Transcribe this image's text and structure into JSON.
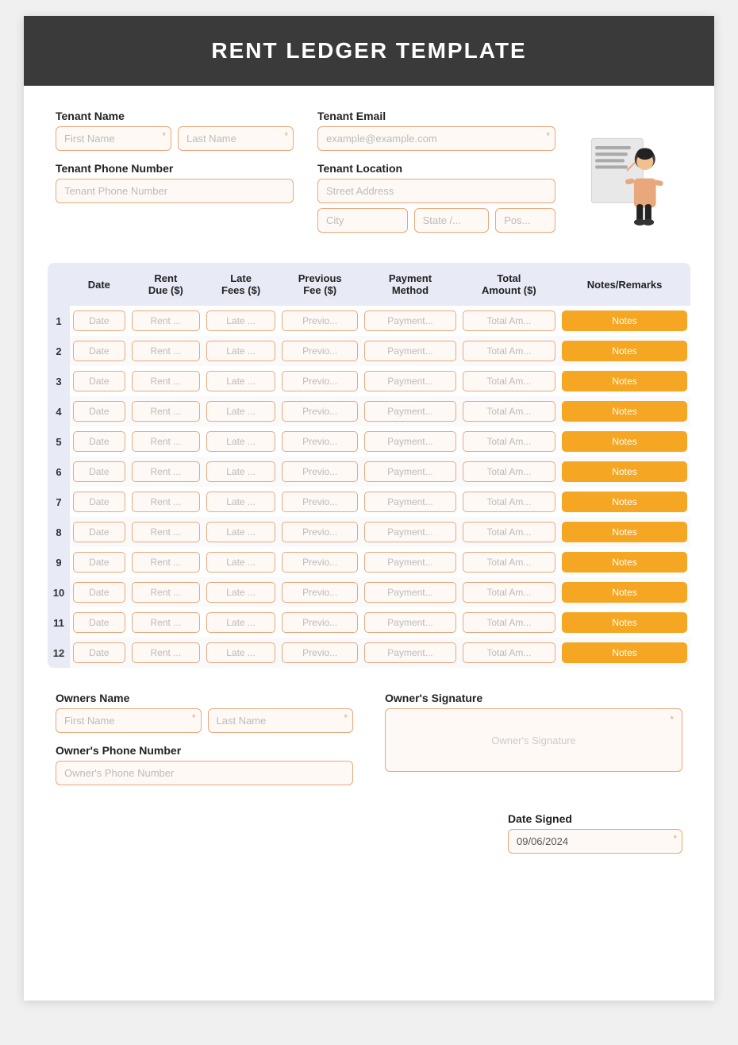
{
  "header": {
    "title": "RENT LEDGER TEMPLATE"
  },
  "tenant": {
    "name_label": "Tenant Name",
    "email_label": "Tenant Email",
    "phone_label": "Tenant Phone Number",
    "location_label": "Tenant Location",
    "first_name_placeholder": "First Name",
    "last_name_placeholder": "Last Name",
    "email_placeholder": "example@example.com",
    "phone_placeholder": "Tenant Phone Number",
    "street_placeholder": "Street Address",
    "city_placeholder": "City",
    "state_placeholder": "State /...",
    "zip_placeholder": "Pos..."
  },
  "table": {
    "columns": [
      "",
      "Date",
      "Rent Due ($)",
      "Late Fees ($)",
      "Previous Fee ($)",
      "Payment Method",
      "Total Amount ($)",
      "Notes/Remarks"
    ],
    "rows": [
      {
        "num": "1",
        "date": "Date",
        "rent": "Rent ...",
        "late": "Late ...",
        "prev": "Previo...",
        "payment": "Payment...",
        "total": "Total Am...",
        "notes": "Notes"
      },
      {
        "num": "2",
        "date": "Date",
        "rent": "Rent ...",
        "late": "Late ...",
        "prev": "Previo...",
        "payment": "Payment...",
        "total": "Total Am...",
        "notes": "Notes"
      },
      {
        "num": "3",
        "date": "Date",
        "rent": "Rent ...",
        "late": "Late ...",
        "prev": "Previo...",
        "payment": "Payment...",
        "total": "Total Am...",
        "notes": "Notes"
      },
      {
        "num": "4",
        "date": "Date",
        "rent": "Rent ...",
        "late": "Late ...",
        "prev": "Previo...",
        "payment": "Payment...",
        "total": "Total Am...",
        "notes": "Notes"
      },
      {
        "num": "5",
        "date": "Date",
        "rent": "Rent ...",
        "late": "Late ...",
        "prev": "Previo...",
        "payment": "Payment...",
        "total": "Total Am...",
        "notes": "Notes"
      },
      {
        "num": "6",
        "date": "Date",
        "rent": "Rent ...",
        "late": "Late ...",
        "prev": "Previo...",
        "payment": "Payment...",
        "total": "Total Am...",
        "notes": "Notes"
      },
      {
        "num": "7",
        "date": "Date",
        "rent": "Rent ...",
        "late": "Late ...",
        "prev": "Previo...",
        "payment": "Payment...",
        "total": "Total Am...",
        "notes": "Notes"
      },
      {
        "num": "8",
        "date": "Date",
        "rent": "Rent ...",
        "late": "Late ...",
        "prev": "Previo...",
        "payment": "Payment...",
        "total": "Total Am...",
        "notes": "Notes"
      },
      {
        "num": "9",
        "date": "Date",
        "rent": "Rent ...",
        "late": "Late ...",
        "prev": "Previo...",
        "payment": "Payment...",
        "total": "Total Am...",
        "notes": "Notes"
      },
      {
        "num": "10",
        "date": "Date",
        "rent": "Rent ...",
        "late": "Late ...",
        "prev": "Previo...",
        "payment": "Payment...",
        "total": "Total Am...",
        "notes": "Notes"
      },
      {
        "num": "11",
        "date": "Date",
        "rent": "Rent ...",
        "late": "Late ...",
        "prev": "Previo...",
        "payment": "Payment...",
        "total": "Total Am...",
        "notes": "Notes"
      },
      {
        "num": "12",
        "date": "Date",
        "rent": "Rent ...",
        "late": "Late ...",
        "prev": "Previo...",
        "payment": "Payment...",
        "total": "Total Am...",
        "notes": "Notes"
      }
    ]
  },
  "owner": {
    "name_label": "Owners Name",
    "first_name_placeholder": "First Name",
    "last_name_placeholder": "Last Name",
    "phone_label": "Owner's Phone Number",
    "phone_placeholder": "Owner's Phone Number",
    "signature_label": "Owner's Signature",
    "signature_placeholder": "Owner's Signature",
    "date_label": "Date Signed",
    "date_value": "09/06/2024"
  }
}
